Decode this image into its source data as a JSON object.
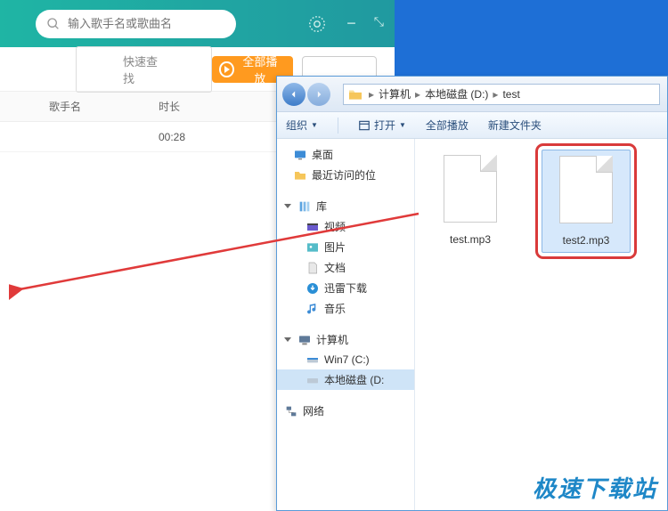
{
  "music_app": {
    "search_placeholder": "输入歌手名或歌曲名",
    "toolbar": {
      "quick_find_label": "快速查找",
      "play_all_label": "全部播放"
    },
    "table": {
      "headers": {
        "artist": "歌手名",
        "duration": "时长"
      },
      "rows": [
        {
          "artist": "",
          "duration": "00:28"
        }
      ]
    }
  },
  "explorer": {
    "breadcrumb": {
      "seg1": "计算机",
      "seg2": "本地磁盘 (D:)",
      "seg3": "test"
    },
    "toolbar": {
      "organize": "组织",
      "open": "打开",
      "play_all": "全部播放",
      "new_folder": "新建文件夹"
    },
    "tree": {
      "desktop": "桌面",
      "recent": "最近访问的位",
      "libraries": "库",
      "video": "视频",
      "pictures": "图片",
      "documents": "文档",
      "xunlei": "迅雷下载",
      "music": "音乐",
      "computer": "计算机",
      "c_drive": "Win7 (C:)",
      "d_drive": "本地磁盘 (D:",
      "network": "网络"
    },
    "files": [
      {
        "name": "test.mp3",
        "selected": false
      },
      {
        "name": "test2.mp3",
        "selected": true
      }
    ]
  },
  "watermark": "极速下载站"
}
